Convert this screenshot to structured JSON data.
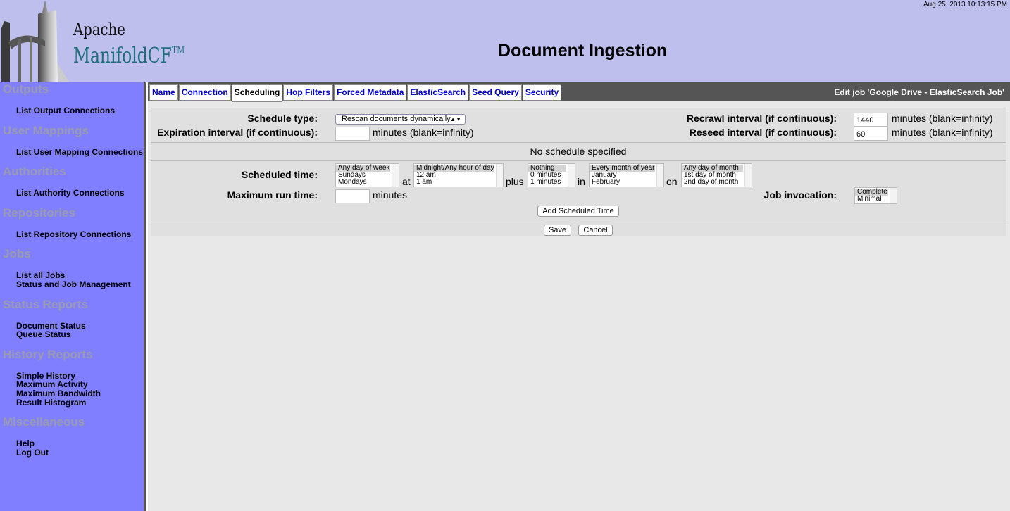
{
  "header": {
    "timestamp": "Aug 25, 2013 10:13:15 PM",
    "logo_apache": "Apache",
    "logo_product": "ManifoldCF",
    "logo_tm": "TM",
    "page_title": "Document Ingestion"
  },
  "sidebar": {
    "sections": [
      {
        "title": "Outputs",
        "links": [
          "List Output Connections"
        ]
      },
      {
        "title": "User Mappings",
        "links": [
          "List User Mapping Connections"
        ]
      },
      {
        "title": "Authorities",
        "links": [
          "List Authority Connections"
        ]
      },
      {
        "title": "Repositories",
        "links": [
          "List Repository Connections"
        ]
      },
      {
        "title": "Jobs",
        "links": [
          "List all Jobs",
          "Status and Job Management"
        ]
      },
      {
        "title": "Status Reports",
        "links": [
          "Document Status",
          "Queue Status"
        ]
      },
      {
        "title": "History Reports",
        "links": [
          "Simple History",
          "Maximum Activity",
          "Maximum Bandwidth",
          "Result Histogram"
        ]
      },
      {
        "title": "Miscellaneous",
        "links": [
          "Help",
          "Log Out"
        ]
      }
    ]
  },
  "tabs": {
    "items": [
      "Name",
      "Connection",
      "Scheduling",
      "Hop Filters",
      "Forced Metadata",
      "ElasticSearch",
      "Seed Query",
      "Security"
    ],
    "active": "Scheduling",
    "edit_title": "Edit job 'Google Drive - ElasticSearch Job'"
  },
  "form": {
    "schedule_type_label": "Schedule type:",
    "schedule_type_value": "Rescan documents dynamically",
    "recrawl_label": "Recrawl interval (if continuous):",
    "recrawl_value": "1440",
    "recrawl_unit": "minutes (blank=infinity)",
    "expiration_label": "Expiration interval (if continuous):",
    "expiration_value": "",
    "expiration_unit": "minutes (blank=infinity)",
    "reseed_label": "Reseed interval (if continuous):",
    "reseed_value": "60",
    "reseed_unit": "minutes (blank=infinity)",
    "no_schedule": "No schedule specified",
    "scheduled_time_label": "Scheduled time:",
    "day_of_week_options": [
      "Any day of week",
      "Sundays",
      "Mondays"
    ],
    "at_word": "at",
    "hour_options": [
      "Midnight/Any hour of day",
      "12 am",
      "1 am"
    ],
    "plus_word": "plus",
    "minutes_options": [
      "Nothing",
      "0 minutes",
      "1 minutes"
    ],
    "in_word": "in",
    "month_options": [
      "Every month of year",
      "January",
      "February"
    ],
    "on_word": "on",
    "day_of_month_options": [
      "Any day of month",
      "1st day of month",
      "2nd day of month"
    ],
    "max_run_label": "Maximum run time:",
    "max_run_value": "",
    "max_run_unit": "minutes",
    "job_invocation_label": "Job invocation:",
    "job_invocation_options": [
      "Complete",
      "Minimal"
    ],
    "add_scheduled_time": "Add Scheduled Time",
    "save": "Save",
    "cancel": "Cancel"
  }
}
